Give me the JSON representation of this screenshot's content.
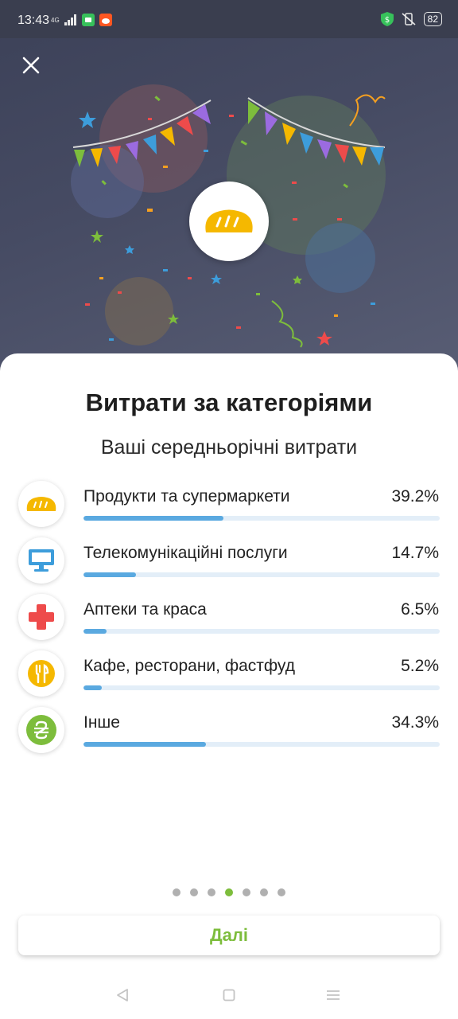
{
  "status_bar": {
    "time": "13:43",
    "network": "4G",
    "battery": "82"
  },
  "hero": {
    "badge_icon": "bread-icon"
  },
  "sheet": {
    "title": "Витрати за категоріями",
    "subtitle": "Ваші середньорічні витрати",
    "categories": [
      {
        "label": "Продукти та супермаркети",
        "percent_text": "39.2%",
        "percent": 39.2,
        "icon": "bread-icon",
        "icon_color": "#f5b800"
      },
      {
        "label": "Телекомунікаційні послуги",
        "percent_text": "14.7%",
        "percent": 14.7,
        "icon": "monitor-icon",
        "icon_color": "#3d9ddb"
      },
      {
        "label": "Аптеки та краса",
        "percent_text": "6.5%",
        "percent": 6.5,
        "icon": "medical-cross-icon",
        "icon_color": "#ee4b4b"
      },
      {
        "label": "Кафе, ресторани, фастфуд",
        "percent_text": "5.2%",
        "percent": 5.2,
        "icon": "fork-knife-icon",
        "icon_color": "#f5b800"
      },
      {
        "label": "Інше",
        "percent_text": "34.3%",
        "percent": 34.3,
        "icon": "hryvnia-icon",
        "icon_color": "#7dbd3c"
      }
    ],
    "pagination": {
      "total": 7,
      "active_index": 3
    },
    "next_button": "Далі"
  },
  "colors": {
    "accent_green": "#7dbd3c",
    "bar_fill": "#5aa9e0",
    "bar_track": "#e3eef8"
  }
}
